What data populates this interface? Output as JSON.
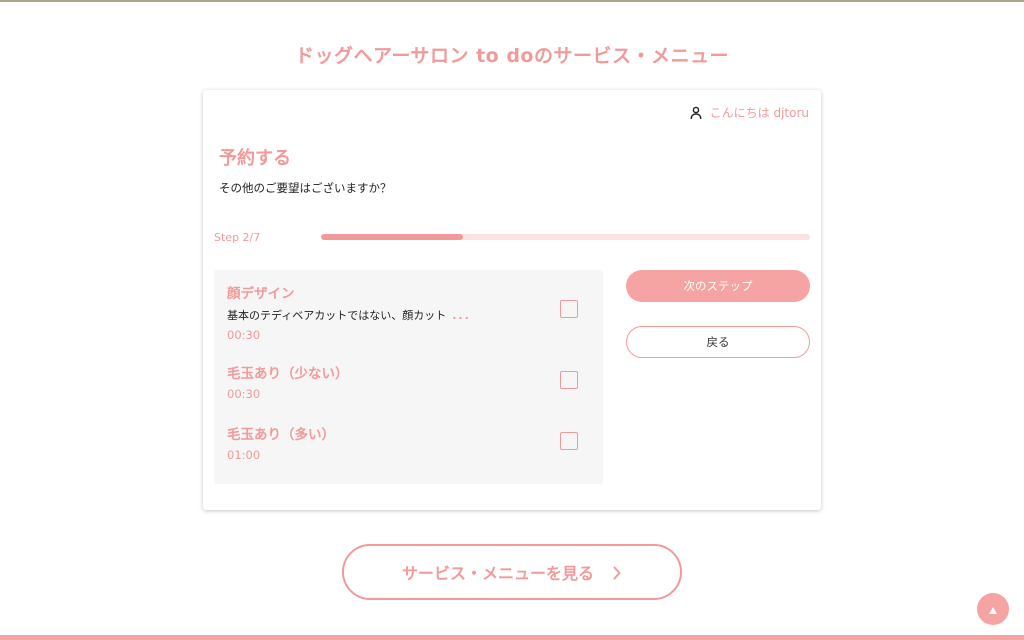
{
  "page": {
    "title": "ドッグヘアーサロン to doのサービス・メニュー"
  },
  "header": {
    "greeting": "こんにちは djtoru",
    "user_icon": "user-icon"
  },
  "booking": {
    "title": "予約する",
    "question": "その他のご要望はございますか？",
    "step_label": "Step 2/7",
    "progress": {
      "current": 2,
      "total": 7,
      "fraction": 0.29
    }
  },
  "options": [
    {
      "name": "顔デザイン",
      "description": "基本のテディベアカットではない、顔カット",
      "more": "...",
      "duration": "00:30",
      "checked": false
    },
    {
      "name": "毛玉あり（少ない）",
      "duration": "00:30",
      "checked": false
    },
    {
      "name": "毛玉あり（多い）",
      "duration": "01:00",
      "checked": false
    }
  ],
  "actions": {
    "next_label": "次のステップ",
    "back_label": "戻る"
  },
  "footer": {
    "menu_link_label": "サービス・メニューを見る",
    "menu_link_icon": "chevron-right-icon",
    "scroll_top_icon": "arrow-up-icon"
  },
  "colors": {
    "accent": "#f29a9a",
    "accent_light": "#fbe3e3",
    "panel_bg": "#f6f6f6"
  }
}
